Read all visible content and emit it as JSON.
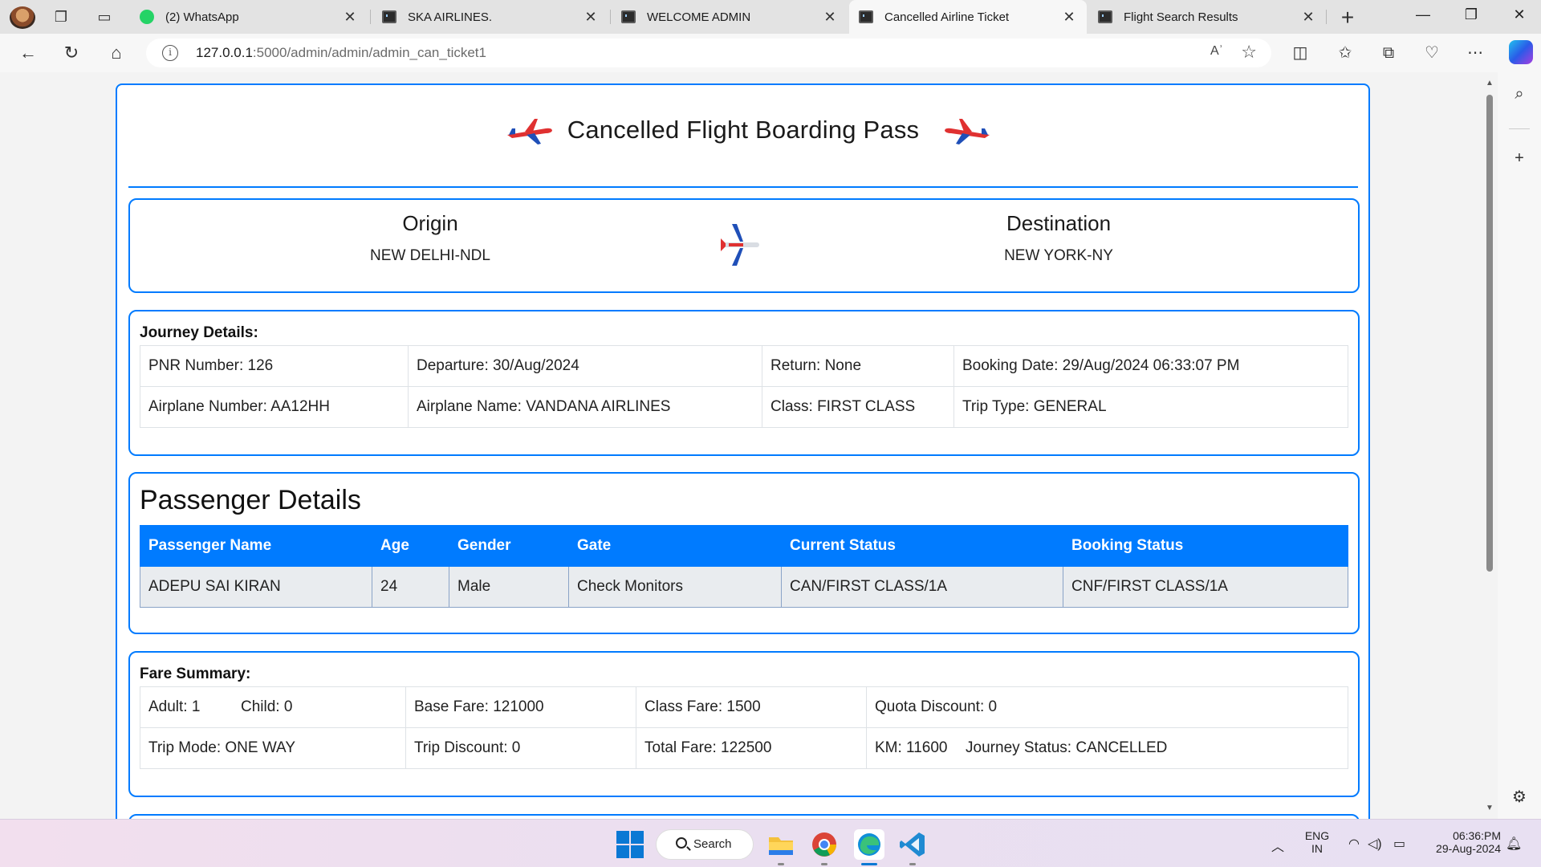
{
  "browser": {
    "tabs": [
      {
        "title": "(2) WhatsApp",
        "icon": "whatsapp-icon",
        "active": false
      },
      {
        "title": "SKA AIRLINES.",
        "icon": "terminal-icon",
        "active": false
      },
      {
        "title": "WELCOME ADMIN",
        "icon": "terminal-icon",
        "active": false
      },
      {
        "title": "Cancelled Airline Ticket",
        "icon": "terminal-icon",
        "active": true
      },
      {
        "title": "Flight Search Results",
        "icon": "terminal-icon",
        "active": false
      }
    ],
    "url_host": "127.0.0.1",
    "url_rest": ":5000/admin/admin/admin_can_ticket1",
    "read_aloud_label": "Aʾ",
    "accent": "#007bff"
  },
  "page": {
    "title": "Cancelled Flight Boarding Pass",
    "route": {
      "origin_label": "Origin",
      "origin_value": "NEW DELHI-NDL",
      "destination_label": "Destination",
      "destination_value": "NEW YORK-NY"
    },
    "journey": {
      "title": "Journey Details:",
      "rows": [
        [
          "PNR Number: 126",
          "Departure: 30/Aug/2024",
          "Return: None",
          "Booking Date: 29/Aug/2024 06:33:07 PM"
        ],
        [
          "Airplane Number: AA12HH",
          "Airplane Name: VANDANA AIRLINES",
          "Class: FIRST CLASS",
          "Trip Type: GENERAL"
        ]
      ]
    },
    "passengers": {
      "title": "Passenger Details",
      "headers": [
        "Passenger Name",
        "Age",
        "Gender",
        "Gate",
        "Current Status",
        "Booking Status"
      ],
      "rows": [
        [
          "ADEPU SAI KIRAN",
          "24",
          "Male",
          "Check Monitors",
          "CAN/FIRST CLASS/1A",
          "CNF/FIRST CLASS/1A"
        ]
      ]
    },
    "fare": {
      "title": "Fare Summary:",
      "adult": "Adult: 1",
      "child": "Child: 0",
      "base_fare": "Base Fare: 121000",
      "class_fare": "Class Fare: 1500",
      "quota_discount": "Quota Discount: 0",
      "trip_mode": "Trip Mode: ONE WAY",
      "trip_discount": "Trip Discount: 0",
      "total_fare": "Total Fare: 122500",
      "km": "KM: 11600",
      "journey_status": "Journey Status: CANCELLED"
    }
  },
  "taskbar": {
    "search_label": "Search",
    "lang_top": "ENG",
    "lang_bottom": "IN",
    "time": "06:36:PM",
    "date": "29-Aug-2024"
  }
}
